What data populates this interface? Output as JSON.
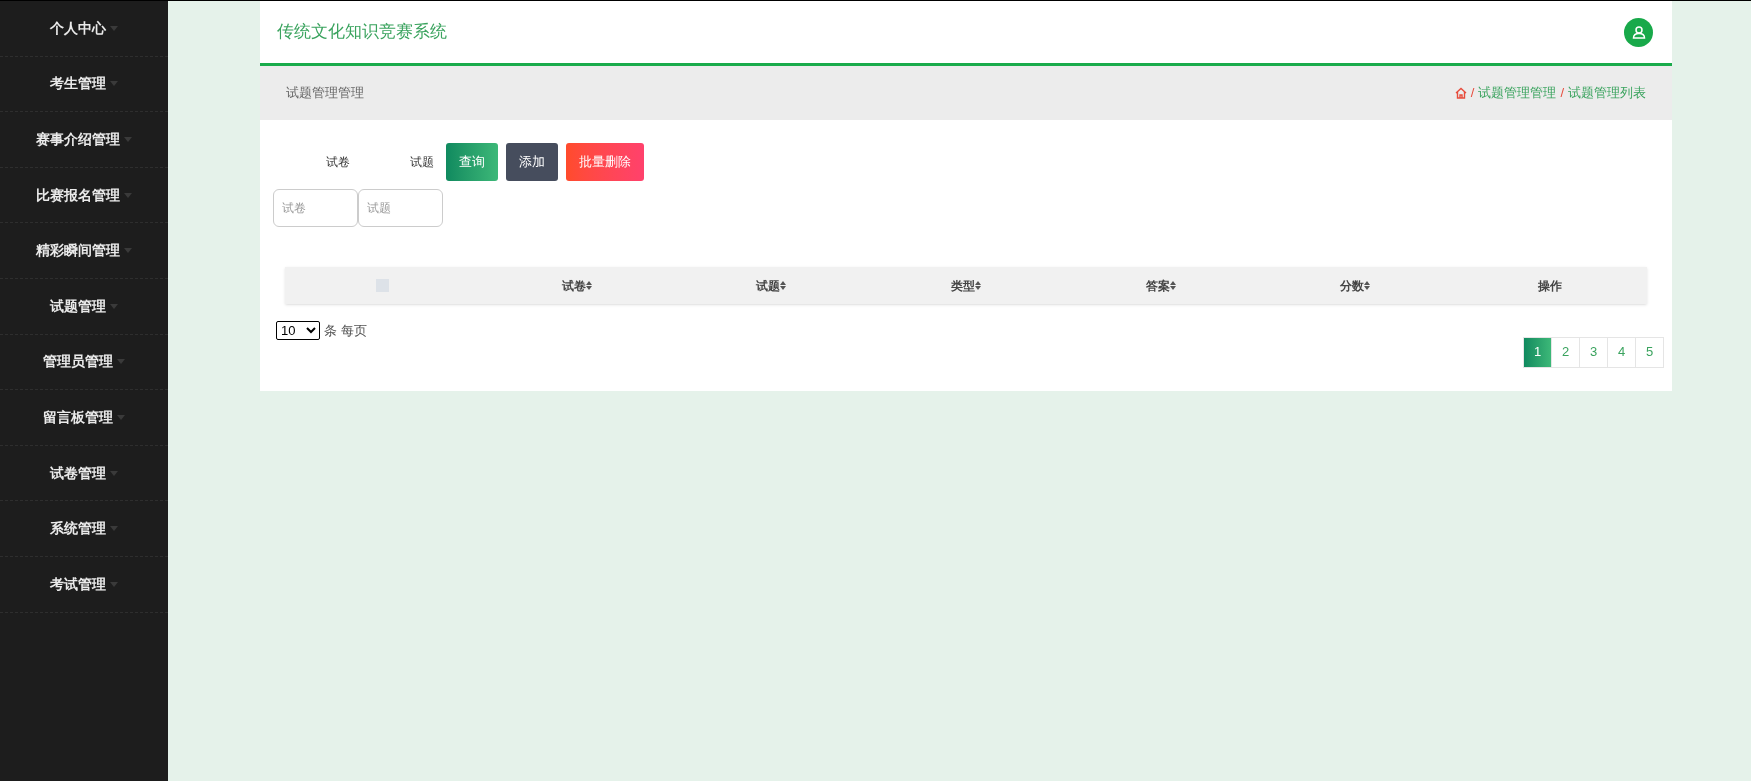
{
  "sidebar": {
    "items": [
      {
        "label": "个人中心"
      },
      {
        "label": "考生管理"
      },
      {
        "label": "赛事介绍管理"
      },
      {
        "label": "比赛报名管理"
      },
      {
        "label": "精彩瞬间管理"
      },
      {
        "label": "试题管理"
      },
      {
        "label": "管理员管理"
      },
      {
        "label": "留言板管理"
      },
      {
        "label": "试卷管理"
      },
      {
        "label": "系统管理"
      },
      {
        "label": "考试管理"
      }
    ]
  },
  "header": {
    "title": "传统文化知识竞赛系统"
  },
  "breadcrumb_bar": {
    "title": "试题管理管理",
    "separator": "/",
    "crumbs": [
      "试题管理管理",
      "试题管理列表"
    ]
  },
  "search": {
    "labels": [
      "试卷",
      "试题"
    ],
    "fields": [
      {
        "placeholder": "试卷"
      },
      {
        "placeholder": "试题"
      }
    ]
  },
  "buttons": [
    {
      "label": "查询",
      "kind": "query"
    },
    {
      "label": "添加",
      "kind": "add"
    },
    {
      "label": "批量删除",
      "kind": "delete"
    }
  ],
  "table": {
    "columns": [
      {
        "kind": "checkbox",
        "checked": false
      },
      {
        "kind": "text",
        "label": "试卷",
        "sortable": true
      },
      {
        "kind": "text",
        "label": "试题",
        "sortable": true
      },
      {
        "kind": "text",
        "label": "类型",
        "sortable": true
      },
      {
        "kind": "text",
        "label": "答案",
        "sortable": true
      },
      {
        "kind": "text",
        "label": "分数",
        "sortable": true
      },
      {
        "kind": "text",
        "label": "操作",
        "sortable": false
      }
    ]
  },
  "page_size": {
    "value": "10",
    "suffix": "条 每页"
  },
  "pagination": [
    {
      "label": "1",
      "selected": true
    },
    {
      "label": "2",
      "selected": false
    },
    {
      "label": "3",
      "selected": false
    },
    {
      "label": "4",
      "selected": false
    },
    {
      "label": "5",
      "selected": false
    }
  ]
}
